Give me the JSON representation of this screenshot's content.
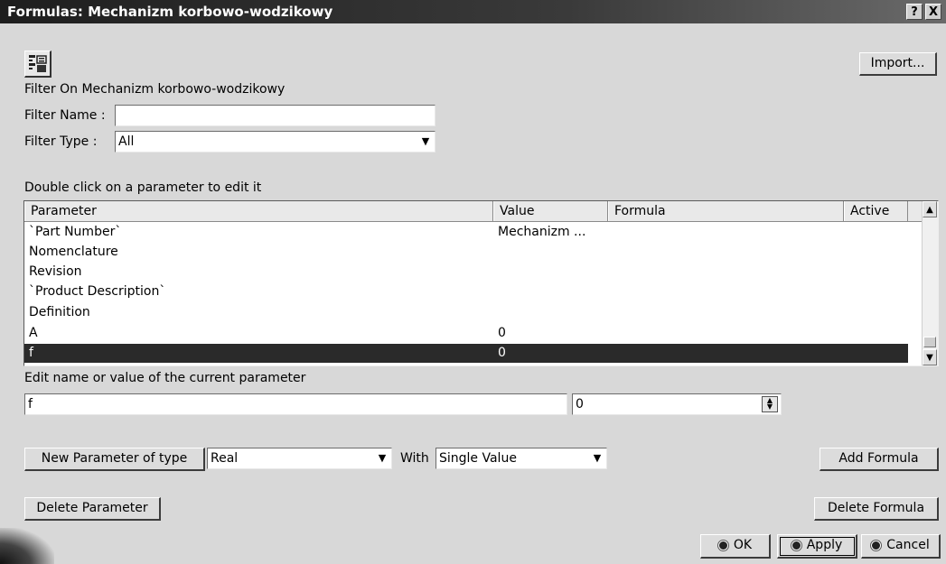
{
  "window": {
    "title": "Formulas: Mechanizm korbowo-wodzikowy",
    "help_btn": "?",
    "close_btn": "X"
  },
  "toolbar": {
    "import_label": "Import..."
  },
  "filter": {
    "on_label": "Filter On Mechanizm korbowo-wodzikowy",
    "name_label": "Filter Name :",
    "name_value": "",
    "type_label": "Filter Type :",
    "type_value": "All"
  },
  "list": {
    "instruction": "Double click on a parameter to edit it",
    "headers": [
      "Parameter",
      "Value",
      "Formula",
      "Active"
    ],
    "rows": [
      {
        "parameter": "`Part Number`",
        "value": "Mechanizm ..."
      },
      {
        "parameter": "Nomenclature",
        "value": ""
      },
      {
        "parameter": "Revision",
        "value": ""
      },
      {
        "parameter": "`Product Description`",
        "value": ""
      },
      {
        "parameter": "Definition",
        "value": ""
      },
      {
        "parameter": "A",
        "value": "0"
      },
      {
        "parameter": "f",
        "value": "0"
      }
    ]
  },
  "edit": {
    "label": "Edit name or value of the current parameter",
    "name_value": "f",
    "param_value": "0"
  },
  "new_param": {
    "button_label": "New Parameter of type",
    "type_value": "Real",
    "with_label": "With",
    "with_value": "Single Value",
    "add_formula_label": "Add Formula"
  },
  "delete": {
    "delete_param_label": "Delete Parameter",
    "delete_formula_label": "Delete Formula"
  },
  "footer": {
    "ok_label": "OK",
    "apply_label": "Apply",
    "cancel_label": "Cancel"
  }
}
